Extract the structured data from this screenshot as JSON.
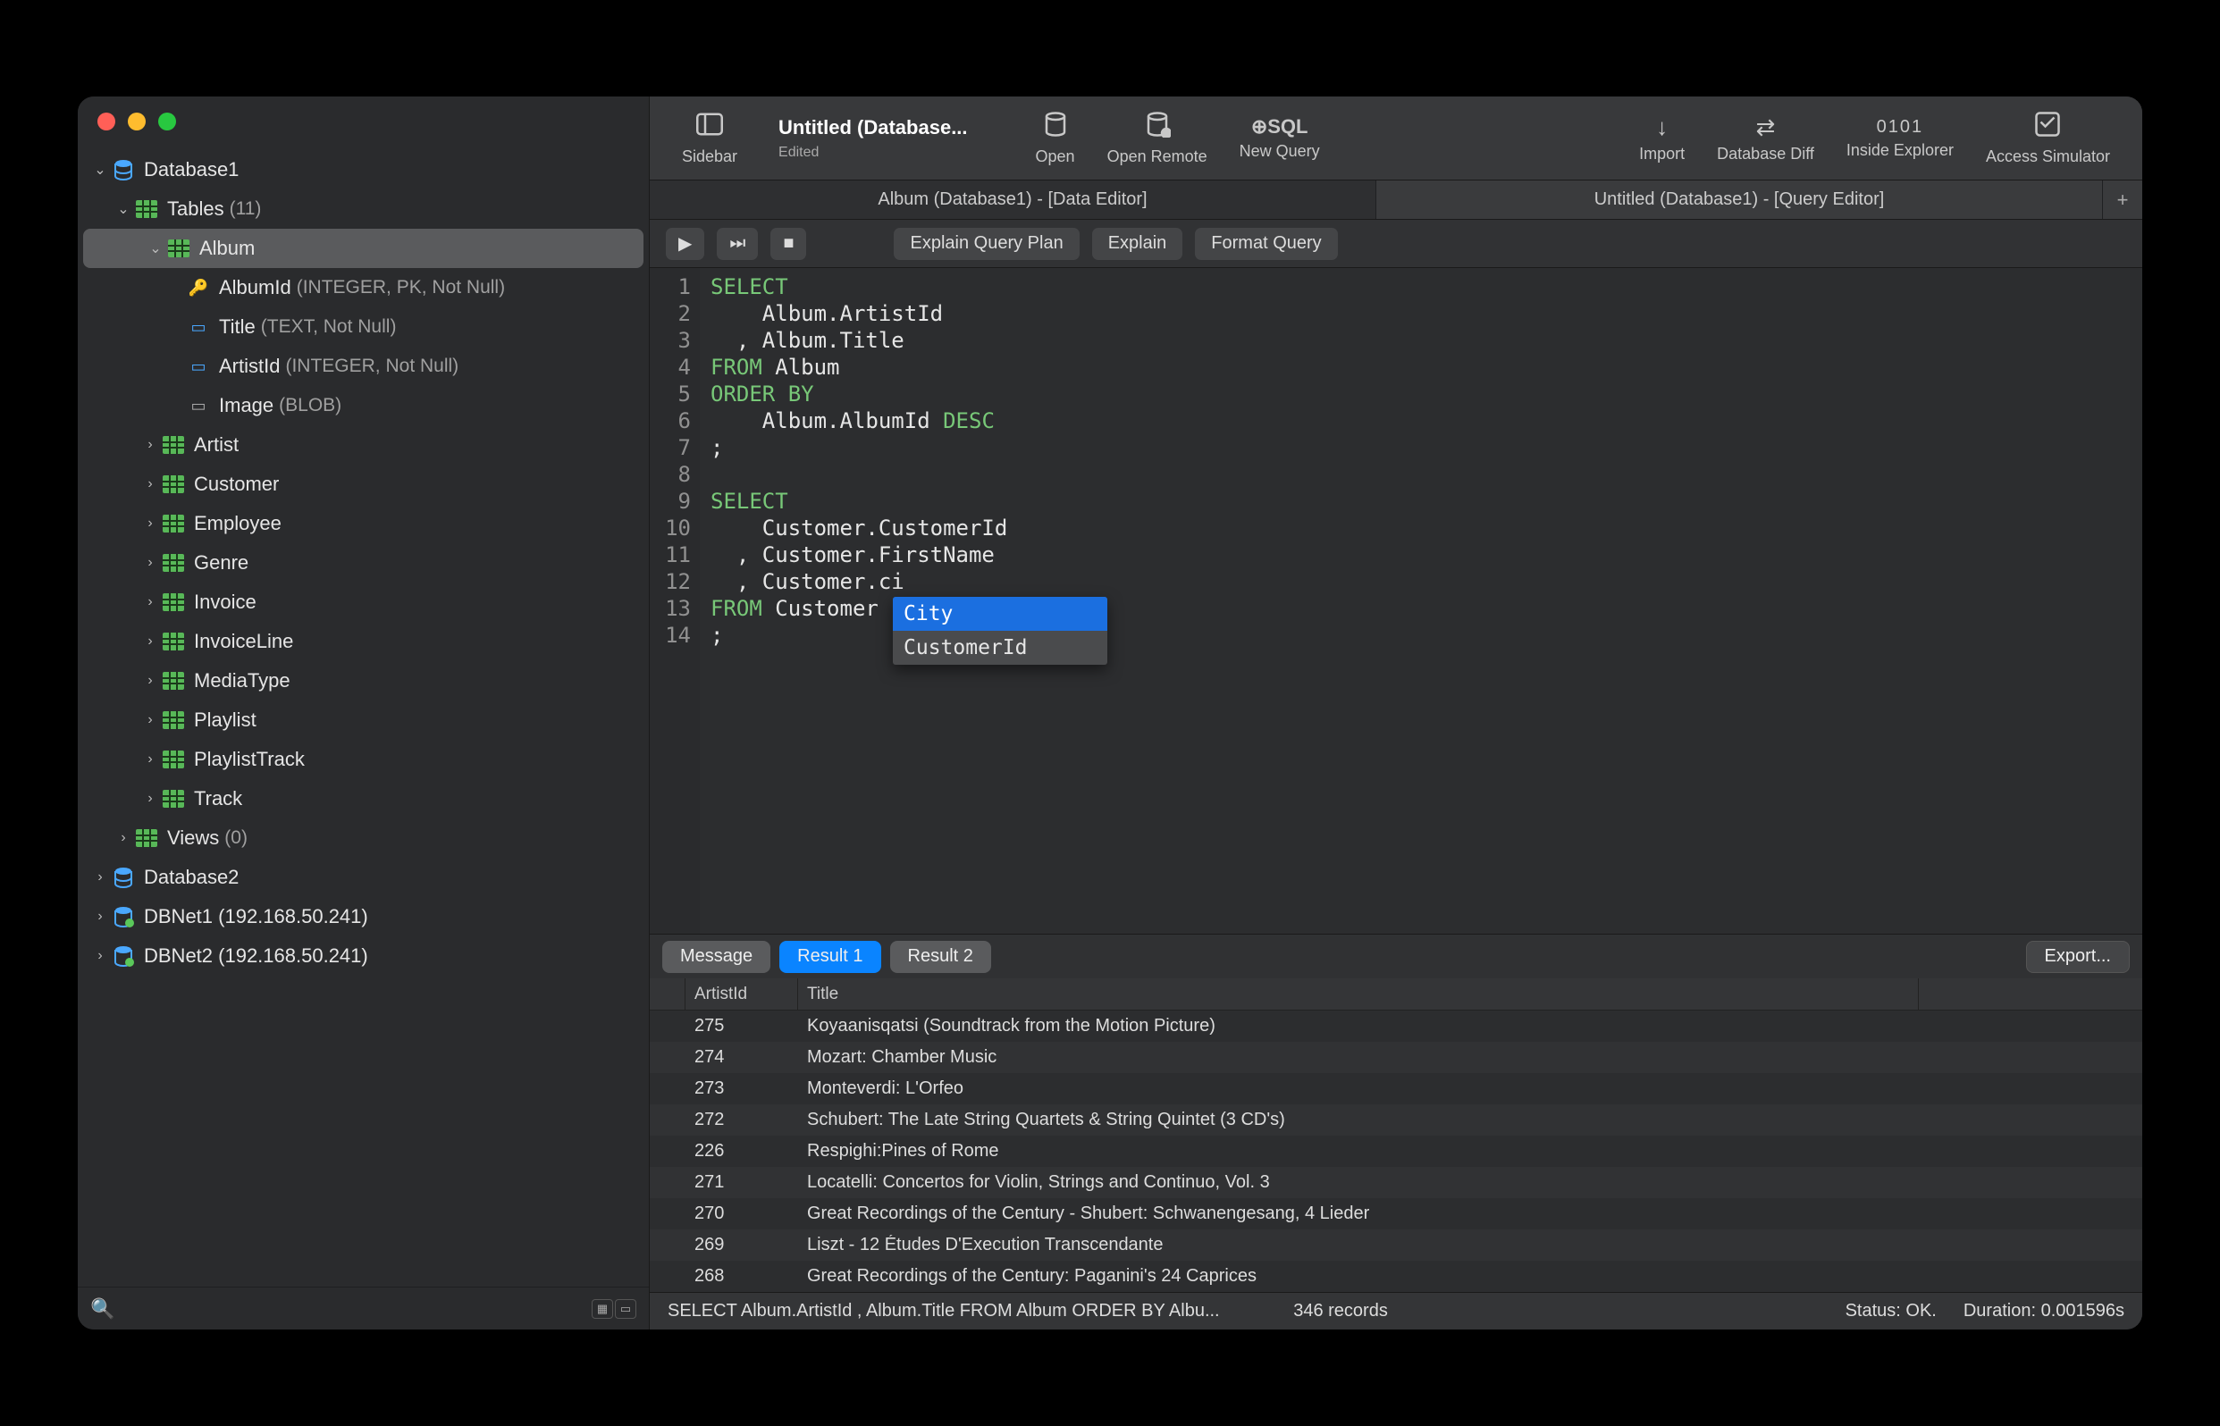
{
  "window": {
    "title": "Untitled (Database...",
    "subtitle": "Edited"
  },
  "toolbar": {
    "sidebar": "Sidebar",
    "open": "Open",
    "open_remote": "Open Remote",
    "new_query": "New Query",
    "new_query_icon": "⊕SQL",
    "import": "Import",
    "diff": "Database Diff",
    "inside_explorer": "Inside Explorer",
    "inside_binary": "0101",
    "access_sim": "Access Simulator"
  },
  "tabs": [
    {
      "label": "Album (Database1) - [Data Editor]",
      "active": false
    },
    {
      "label": "Untitled (Database1) - [Query Editor]",
      "active": true
    }
  ],
  "query_buttons": {
    "explain": "Explain Query Plan",
    "explain2": "Explain",
    "format": "Format Query"
  },
  "sidebar": {
    "databases": [
      {
        "name": "Database1",
        "expanded": true,
        "type": "db",
        "children": [
          {
            "name": "Tables",
            "meta": "(11)",
            "expanded": true,
            "type": "folder",
            "children": [
              {
                "name": "Album",
                "expanded": true,
                "type": "table",
                "selected": true,
                "columns": [
                  {
                    "name": "AlbumId",
                    "meta": "(INTEGER, PK, Not Null)",
                    "icon": "pk"
                  },
                  {
                    "name": "Title",
                    "meta": "(TEXT, Not Null)",
                    "icon": "col"
                  },
                  {
                    "name": "ArtistId",
                    "meta": "(INTEGER, Not Null)",
                    "icon": "col"
                  },
                  {
                    "name": "Image",
                    "meta": "(BLOB)",
                    "icon": "blob"
                  }
                ]
              },
              {
                "name": "Artist",
                "type": "table"
              },
              {
                "name": "Customer",
                "type": "table"
              },
              {
                "name": "Employee",
                "type": "table"
              },
              {
                "name": "Genre",
                "type": "table"
              },
              {
                "name": "Invoice",
                "type": "table"
              },
              {
                "name": "InvoiceLine",
                "type": "table"
              },
              {
                "name": "MediaType",
                "type": "table"
              },
              {
                "name": "Playlist",
                "type": "table"
              },
              {
                "name": "PlaylistTrack",
                "type": "table"
              },
              {
                "name": "Track",
                "type": "table"
              }
            ]
          },
          {
            "name": "Views",
            "meta": "(0)",
            "type": "folder"
          }
        ]
      },
      {
        "name": "Database2",
        "type": "db"
      },
      {
        "name": "DBNet1 (192.168.50.241)",
        "type": "remote"
      },
      {
        "name": "DBNet2 (192.168.50.241)",
        "type": "remote"
      }
    ]
  },
  "editor": {
    "lines": [
      "SELECT",
      "    Album.ArtistId",
      "  , Album.Title",
      "FROM Album",
      "ORDER BY",
      "    Album.AlbumId DESC",
      ";",
      "",
      "SELECT",
      "    Customer.CustomerId",
      "  , Customer.FirstName",
      "  , Customer.ci",
      "FROM Customer",
      ";"
    ],
    "autocomplete": [
      "City",
      "CustomerId"
    ]
  },
  "results": {
    "segments": [
      "Message",
      "Result 1",
      "Result 2"
    ],
    "active_segment": "Result 1",
    "export_label": "Export...",
    "columns": [
      "ArtistId",
      "Title"
    ],
    "rows": [
      {
        "artist": "275",
        "title": "Koyaanisqatsi (Soundtrack from the Motion Picture)"
      },
      {
        "artist": "274",
        "title": "Mozart: Chamber Music"
      },
      {
        "artist": "273",
        "title": "Monteverdi: L'Orfeo"
      },
      {
        "artist": "272",
        "title": "Schubert: The Late String Quartets & String Quintet (3 CD's)"
      },
      {
        "artist": "226",
        "title": "Respighi:Pines of Rome"
      },
      {
        "artist": "271",
        "title": "Locatelli: Concertos for Violin, Strings and Continuo, Vol. 3"
      },
      {
        "artist": "270",
        "title": "Great Recordings of the Century - Shubert: Schwanengesang, 4 Lieder"
      },
      {
        "artist": "269",
        "title": "Liszt - 12 Études D'Execution Transcendante"
      },
      {
        "artist": "268",
        "title": "Great Recordings of the Century: Paganini's 24 Caprices"
      }
    ]
  },
  "statusbar": {
    "query": "SELECT    Album.ArtistId  , Album.Title FROM Album ORDER BY    Albu...",
    "records": "346 records",
    "status": "Status: OK.",
    "duration": "Duration: 0.001596s"
  }
}
